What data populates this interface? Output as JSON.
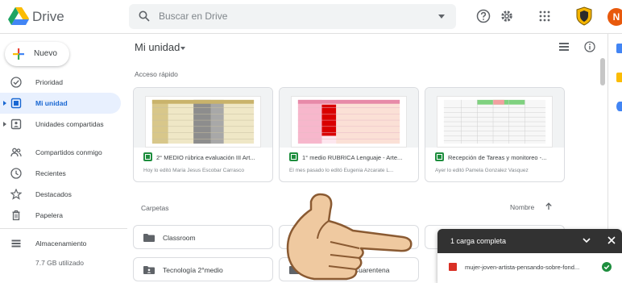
{
  "header": {
    "brand": "Drive",
    "search_placeholder": "Buscar en Drive",
    "avatar_initial": "N"
  },
  "sidebar": {
    "new_label": "Nuevo",
    "items": [
      {
        "label": "Prioridad",
        "icon": "checkbox-icon"
      },
      {
        "label": "Mi unidad",
        "icon": "my-drive-icon",
        "active": true
      },
      {
        "label": "Unidades compartidas",
        "icon": "shared-drives-icon"
      },
      {
        "label": "Compartidos conmigo",
        "icon": "people-icon"
      },
      {
        "label": "Recientes",
        "icon": "clock-icon"
      },
      {
        "label": "Destacados",
        "icon": "star-icon"
      },
      {
        "label": "Papelera",
        "icon": "trash-icon"
      },
      {
        "label": "Almacenamiento",
        "icon": "storage-icon"
      }
    ],
    "storage_used": "7.7 GB utilizado"
  },
  "main": {
    "title": "Mi unidad",
    "quick_access_label": "Acceso rápido",
    "folders_label": "Carpetas",
    "sort_label": "Nombre",
    "cards": [
      {
        "name": "2° MEDIO rúbrica evaluación III Art...",
        "sub": "Hoy lo editó Maria Jesus Escobar Carrasco"
      },
      {
        "name": "1° medio RUBRICA Lenguaje - Arte...",
        "sub": "El mes pasado lo editó Eugenia Azcarate L..."
      },
      {
        "name": "Recepción de Tareas y monitoreo -...",
        "sub": "Ayer lo editó Pamela Gonzalez Vasquez"
      }
    ],
    "folders": [
      {
        "name": "Classroom"
      },
      {
        "name": ""
      },
      {
        "name": "Tecnología 2°medio"
      },
      {
        "name": "Cuarentena"
      }
    ]
  },
  "toast": {
    "title": "1 carga completa",
    "file_name": "mujer-joven-artista-pensando-sobre-fond..."
  },
  "colors": {
    "accent": "#1967d2",
    "active_bg": "#e8f0fe",
    "avatar": "#e8590c",
    "sheets_green": "#1e8e3e",
    "toast_bg": "#323232"
  }
}
